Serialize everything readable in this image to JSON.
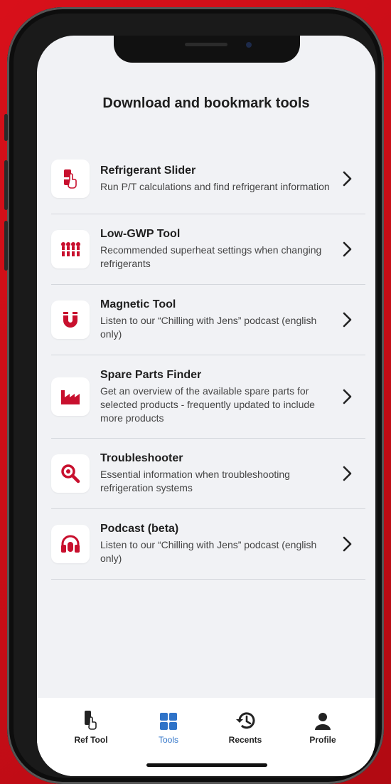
{
  "screen": {
    "title": "Download and bookmark tools"
  },
  "tools": [
    {
      "title": "Refrigerant Slider",
      "description": "Run P/T calculations and find refrigerant information",
      "icon": "refrigerant-slider-icon"
    },
    {
      "title": "Low-GWP Tool",
      "description": "Recommended superheat settings when changing refrigerants",
      "icon": "low-gwp-icon"
    },
    {
      "title": "Magnetic Tool",
      "description": "Listen to our “Chilling with Jens” podcast (english only)",
      "icon": "magnet-icon"
    },
    {
      "title": "Spare Parts Finder",
      "description": "Get an overview of the available spare parts for selected products - frequently updated to include more products",
      "icon": "factory-icon"
    },
    {
      "title": "Troubleshooter",
      "description": "Essential information when troubleshooting refrigeration systems",
      "icon": "magnifier-icon"
    },
    {
      "title": "Podcast (beta)",
      "description": "Listen to our “Chilling with Jens” podcast (english only)",
      "icon": "headphones-icon"
    }
  ],
  "tabbar": {
    "items": [
      {
        "label": "Ref Tool",
        "icon": "ref-tool-icon"
      },
      {
        "label": "Tools",
        "icon": "grid-icon",
        "active": true
      },
      {
        "label": "Recents",
        "icon": "history-icon"
      },
      {
        "label": "Profile",
        "icon": "person-icon"
      }
    ]
  },
  "colors": {
    "accent_red": "#c8102e",
    "active_tab_blue": "#2f73c8",
    "background": "#f1f2f5",
    "brand_backdrop": "#d8101a"
  }
}
